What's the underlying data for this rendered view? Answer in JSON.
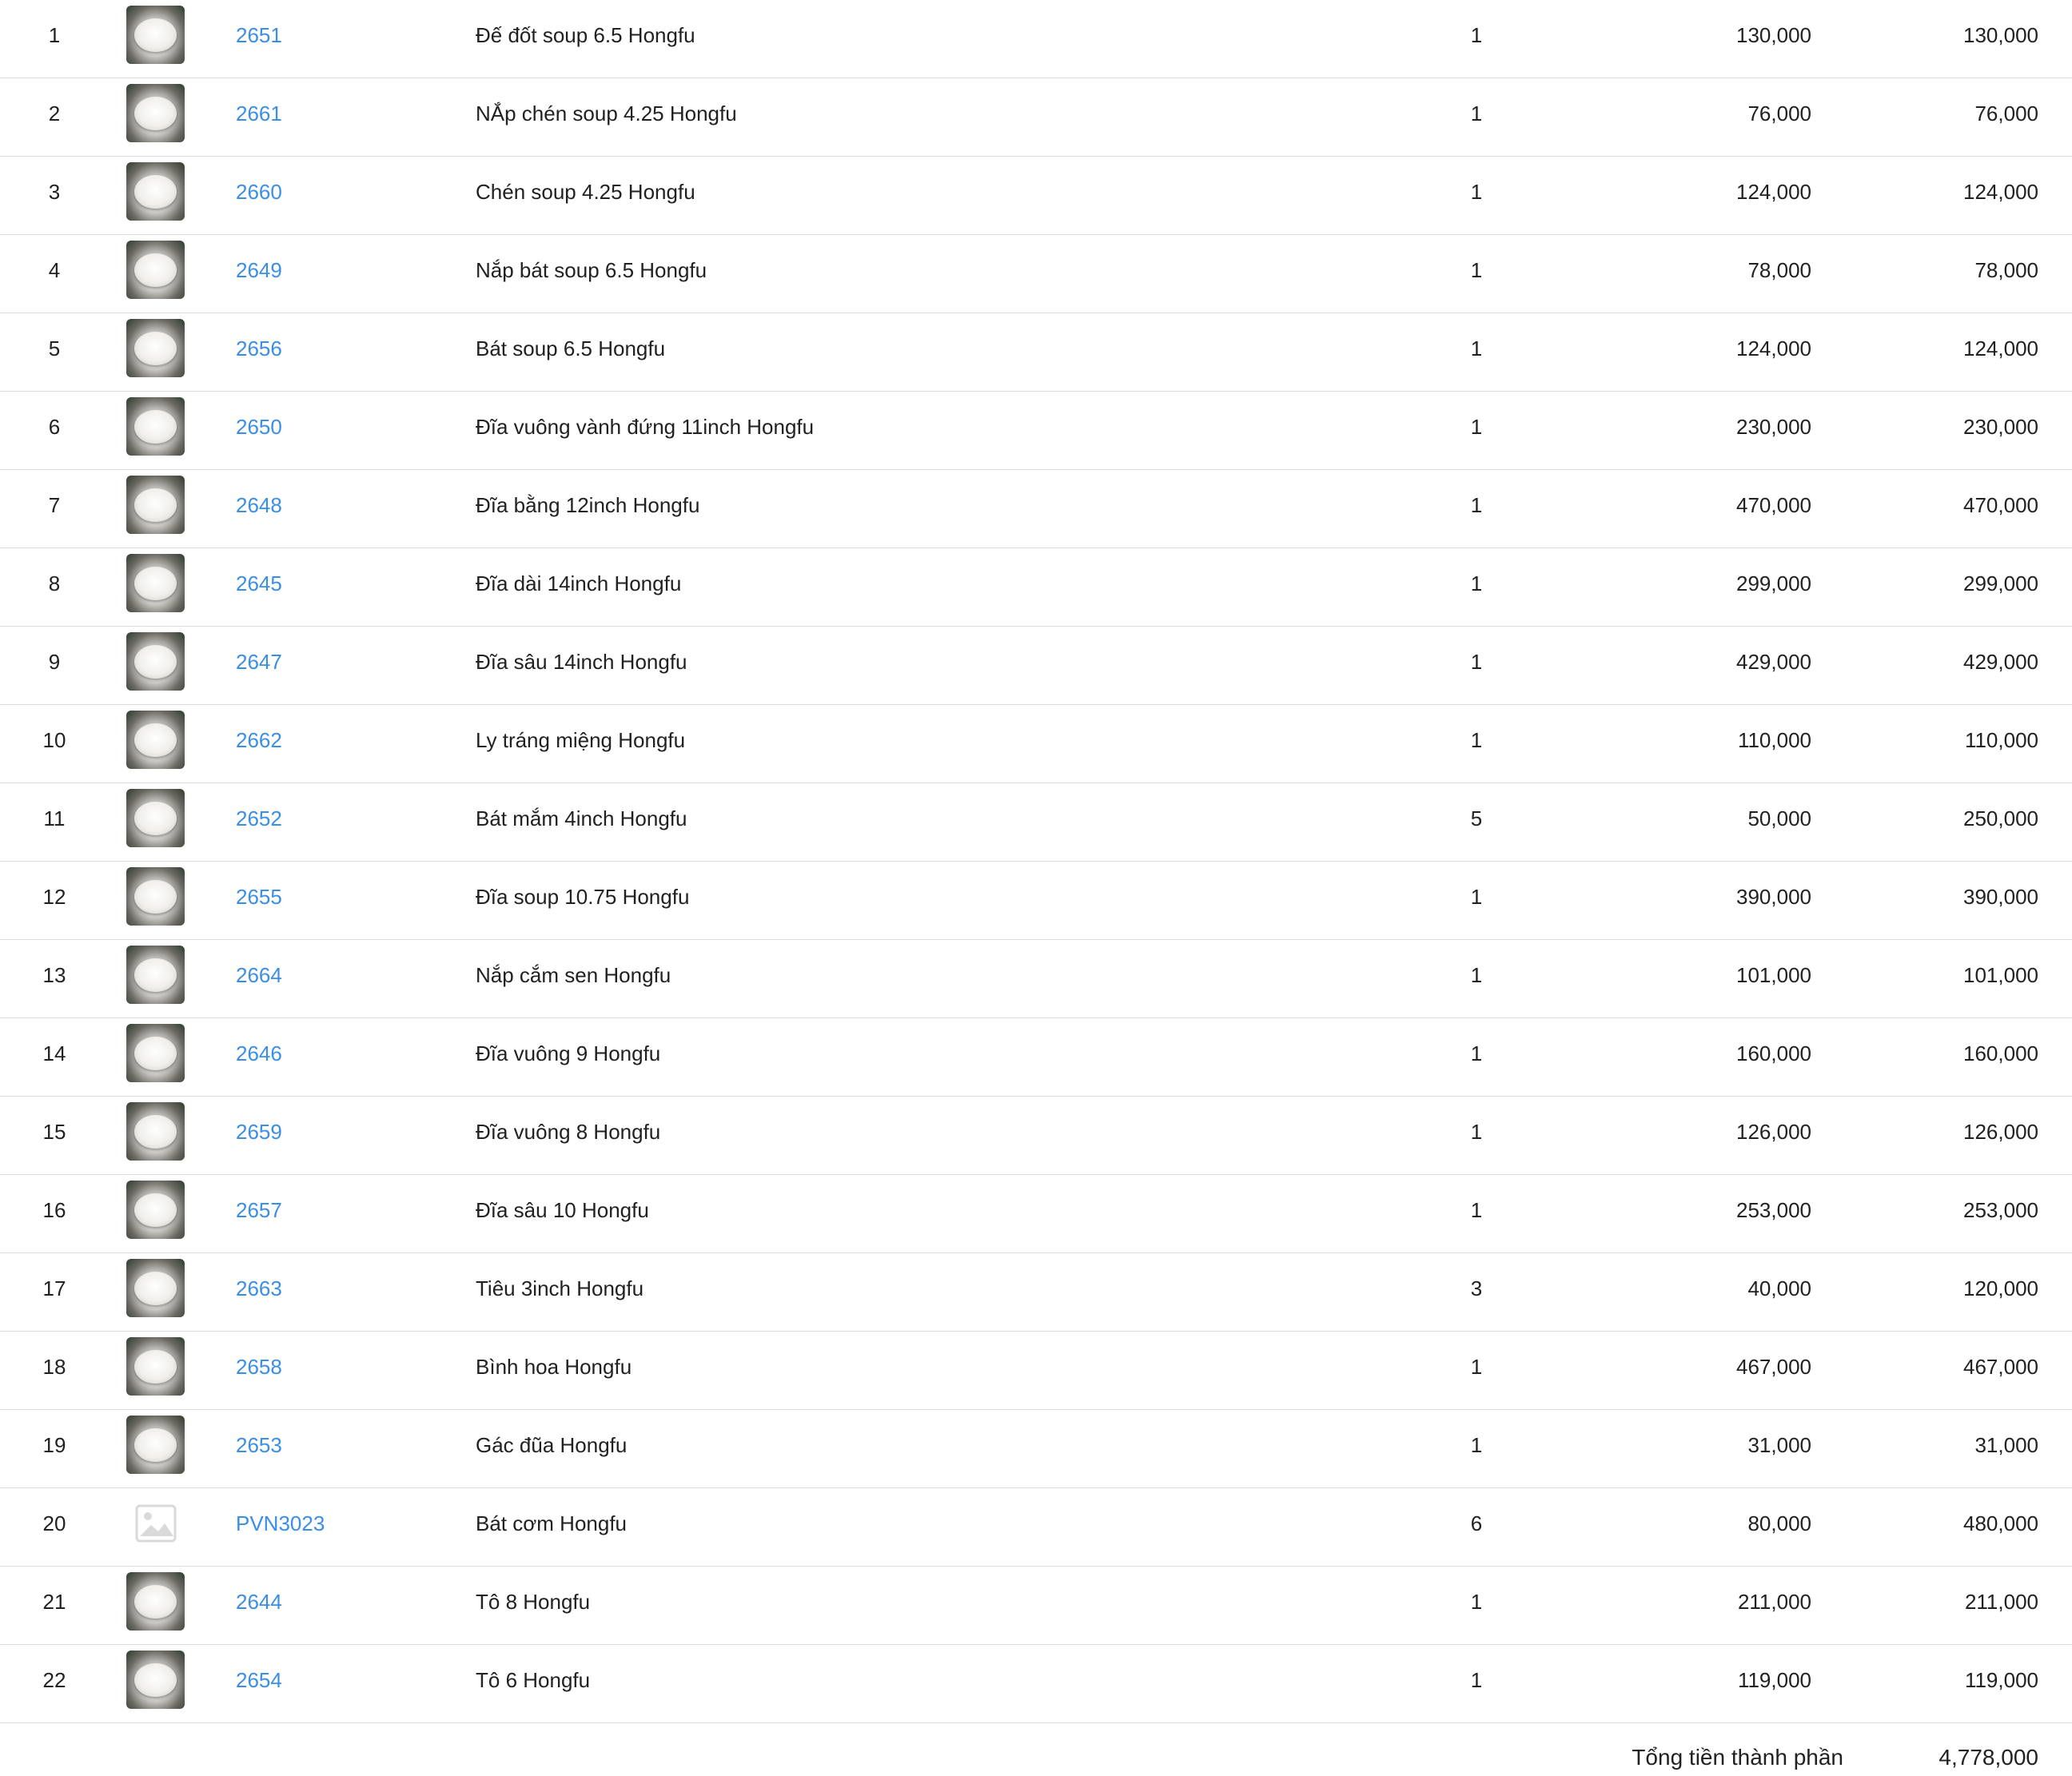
{
  "columns": {
    "index": "",
    "image": "",
    "code": "",
    "name": "",
    "quantity": "",
    "unit_price": "",
    "line_total": ""
  },
  "rows": [
    {
      "index": "1",
      "code": "2651",
      "name": "Đế đốt soup 6.5 Hongfu",
      "quantity": "1",
      "unit_price": "130,000",
      "line_total": "130,000",
      "image": "product-photo"
    },
    {
      "index": "2",
      "code": "2661",
      "name": "NẮp chén soup 4.25 Hongfu",
      "quantity": "1",
      "unit_price": "76,000",
      "line_total": "76,000",
      "image": "product-photo"
    },
    {
      "index": "3",
      "code": "2660",
      "name": "Chén soup 4.25 Hongfu",
      "quantity": "1",
      "unit_price": "124,000",
      "line_total": "124,000",
      "image": "product-photo"
    },
    {
      "index": "4",
      "code": "2649",
      "name": "Nắp bát soup 6.5 Hongfu",
      "quantity": "1",
      "unit_price": "78,000",
      "line_total": "78,000",
      "image": "product-photo"
    },
    {
      "index": "5",
      "code": "2656",
      "name": "Bát soup 6.5 Hongfu",
      "quantity": "1",
      "unit_price": "124,000",
      "line_total": "124,000",
      "image": "product-photo"
    },
    {
      "index": "6",
      "code": "2650",
      "name": "Đĩa vuông vành đứng 11inch Hongfu",
      "quantity": "1",
      "unit_price": "230,000",
      "line_total": "230,000",
      "image": "product-photo"
    },
    {
      "index": "7",
      "code": "2648",
      "name": "Đĩa bằng 12inch Hongfu",
      "quantity": "1",
      "unit_price": "470,000",
      "line_total": "470,000",
      "image": "product-photo"
    },
    {
      "index": "8",
      "code": "2645",
      "name": "Đĩa dài 14inch Hongfu",
      "quantity": "1",
      "unit_price": "299,000",
      "line_total": "299,000",
      "image": "product-photo"
    },
    {
      "index": "9",
      "code": "2647",
      "name": "Đĩa sâu 14inch Hongfu",
      "quantity": "1",
      "unit_price": "429,000",
      "line_total": "429,000",
      "image": "product-photo"
    },
    {
      "index": "10",
      "code": "2662",
      "name": "Ly tráng miệng Hongfu",
      "quantity": "1",
      "unit_price": "110,000",
      "line_total": "110,000",
      "image": "product-photo"
    },
    {
      "index": "11",
      "code": "2652",
      "name": "Bát mắm 4inch Hongfu",
      "quantity": "5",
      "unit_price": "50,000",
      "line_total": "250,000",
      "image": "product-photo"
    },
    {
      "index": "12",
      "code": "2655",
      "name": "Đĩa soup 10.75 Hongfu",
      "quantity": "1",
      "unit_price": "390,000",
      "line_total": "390,000",
      "image": "product-photo"
    },
    {
      "index": "13",
      "code": "2664",
      "name": "Nắp cắm sen Hongfu",
      "quantity": "1",
      "unit_price": "101,000",
      "line_total": "101,000",
      "image": "product-photo"
    },
    {
      "index": "14",
      "code": "2646",
      "name": "Đĩa vuông 9 Hongfu",
      "quantity": "1",
      "unit_price": "160,000",
      "line_total": "160,000",
      "image": "product-photo"
    },
    {
      "index": "15",
      "code": "2659",
      "name": "Đĩa vuông 8 Hongfu",
      "quantity": "1",
      "unit_price": "126,000",
      "line_total": "126,000",
      "image": "product-photo"
    },
    {
      "index": "16",
      "code": "2657",
      "name": "Đĩa sâu 10 Hongfu",
      "quantity": "1",
      "unit_price": "253,000",
      "line_total": "253,000",
      "image": "product-photo"
    },
    {
      "index": "17",
      "code": "2663",
      "name": "Tiêu 3inch Hongfu",
      "quantity": "3",
      "unit_price": "40,000",
      "line_total": "120,000",
      "image": "product-photo"
    },
    {
      "index": "18",
      "code": "2658",
      "name": "Bình hoa Hongfu",
      "quantity": "1",
      "unit_price": "467,000",
      "line_total": "467,000",
      "image": "product-photo"
    },
    {
      "index": "19",
      "code": "2653",
      "name": "Gác đũa Hongfu",
      "quantity": "1",
      "unit_price": "31,000",
      "line_total": "31,000",
      "image": "product-photo"
    },
    {
      "index": "20",
      "code": "PVN3023",
      "name": "Bát cơm Hongfu",
      "quantity": "6",
      "unit_price": "80,000",
      "line_total": "480,000",
      "image": "image-placeholder-icon"
    },
    {
      "index": "21",
      "code": "2644",
      "name": "Tô 8 Hongfu",
      "quantity": "1",
      "unit_price": "211,000",
      "line_total": "211,000",
      "image": "product-photo"
    },
    {
      "index": "22",
      "code": "2654",
      "name": "Tô 6 Hongfu",
      "quantity": "1",
      "unit_price": "119,000",
      "line_total": "119,000",
      "image": "product-photo"
    }
  ],
  "summary": {
    "label": "Tổng tiền thành phần",
    "value": "4,778,000"
  },
  "colors": {
    "link": "#3a8ee6",
    "text": "#212121",
    "row_divider": "#dcdcdc",
    "placeholder_icon": "#d9d9d9"
  }
}
